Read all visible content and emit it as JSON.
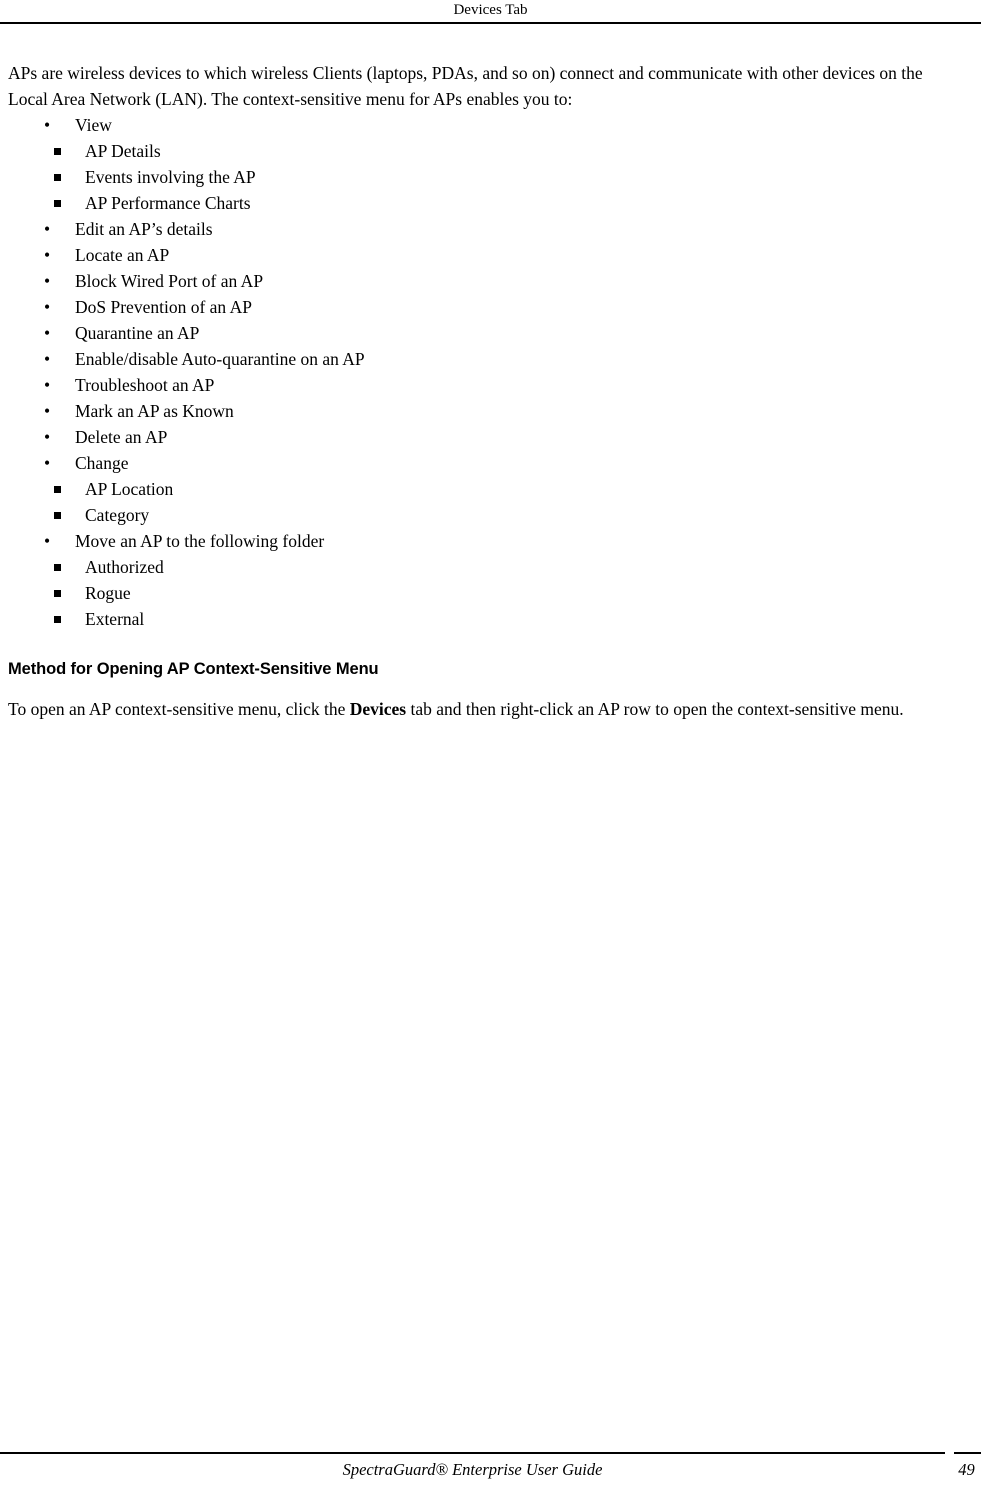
{
  "header": {
    "title": "Devices Tab"
  },
  "intro": {
    "text": "APs are wireless devices to which wireless Clients (laptops, PDAs, and so on) connect and communicate with other devices on the Local Area Network (LAN). The context-sensitive menu for APs enables you to:"
  },
  "bullets": [
    {
      "label": "View",
      "marker": "•",
      "children": [
        "AP Details",
        "Events involving the AP",
        "AP Performance Charts"
      ]
    },
    {
      "label": "Edit an AP’s details",
      "marker": "•",
      "children": []
    },
    {
      "label": "Locate an AP",
      "marker": "•",
      "children": []
    },
    {
      "label": "Block Wired Port of an AP",
      "marker": "•",
      "children": []
    },
    {
      "label": "DoS Prevention of an AP",
      "marker": "•",
      "children": []
    },
    {
      "label": "Quarantine an AP",
      "marker": "•",
      "children": []
    },
    {
      "label": "Enable/disable Auto-quarantine on an AP",
      "marker": "•",
      "children": []
    },
    {
      "label": "Troubleshoot an AP",
      "marker": "•",
      "children": []
    },
    {
      "label": "Mark an AP as Known",
      "marker": "•",
      "children": []
    },
    {
      "label": "Delete an AP",
      "marker": "•",
      "children": []
    },
    {
      "label": "Change",
      "marker": "•",
      "children": [
        "AP Location",
        "Category"
      ]
    },
    {
      "label": "Move an AP to the following folder",
      "marker": "•",
      "children": [
        "Authorized",
        "Rogue",
        "External"
      ]
    }
  ],
  "section": {
    "heading": "Method for Opening AP Context-Sensitive Menu",
    "paragraph_before_bold": "To open an AP context-sensitive menu, click the ",
    "paragraph_bold": "Devices",
    "paragraph_after_bold": " tab and then right-click an AP row to open the context-sensitive menu."
  },
  "footer": {
    "title": "SpectraGuard® Enterprise User Guide",
    "page_number": "49"
  }
}
